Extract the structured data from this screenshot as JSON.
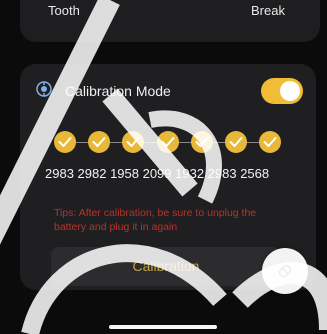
{
  "top_card": {
    "left_text": "Tooth",
    "right_text": "Break"
  },
  "calibration": {
    "icon": "calibration-icon",
    "label": "Calibration Mode",
    "toggle_on": true,
    "steps_completed": 7,
    "values": "2983 2982 1958 2099 1932 2983 2568",
    "tips": "Tips: After calibration, be sure to unplug the battery and plug it in again",
    "button_label": "Calibration"
  },
  "fab": {
    "icon": "pill-edit-icon"
  },
  "colors": {
    "accent": "#f2bd36",
    "step": "#e8b838",
    "tips": "#b5332c",
    "button_text": "#c9a444"
  }
}
